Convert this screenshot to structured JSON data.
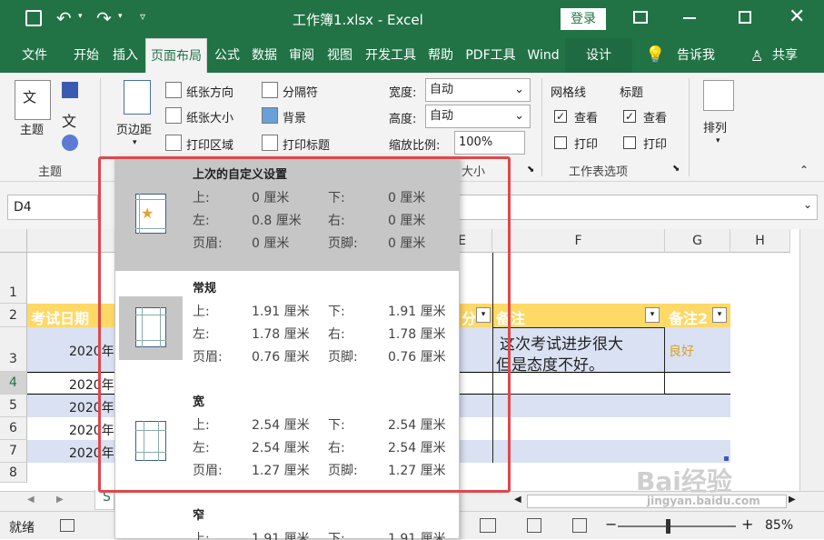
{
  "titlebar": {
    "title": "工作簿1.xlsx - Excel",
    "login_label": "登录"
  },
  "tabs": [
    "文件",
    "开始",
    "插入",
    "页面布局",
    "公式",
    "数据",
    "审阅",
    "视图",
    "开发工具",
    "帮助",
    "PDF工具",
    "Wind",
    "设计"
  ],
  "tell_me": "告诉我",
  "share": "共享",
  "ribbon": {
    "theme_btn": "主题",
    "theme_sub": "文",
    "group_theme": "主题",
    "margins_btn": "页边距",
    "orientation": "纸张方向",
    "size": "纸张大小",
    "print_area": "打印区域",
    "breaks": "分隔符",
    "background": "背景",
    "print_titles": "打印标题",
    "width_label": "宽度:",
    "width_value": "自动",
    "height_label": "高度:",
    "height_value": "自动",
    "scale_label": "缩放比例:",
    "scale_value": "100%",
    "group_scale_partial": "大小",
    "gridlines": "网格线",
    "headings": "标题",
    "view1": "查看",
    "view2": "查看",
    "print1": "打印",
    "print2": "打印",
    "group_sheet_options": "工作表选项",
    "arrange": "排列"
  },
  "namebox": "D4",
  "columns": [
    "A",
    "E",
    "F",
    "G",
    "H"
  ],
  "rows": [
    "1",
    "2",
    "3",
    "4",
    "5",
    "6",
    "7",
    "8"
  ],
  "cells": {
    "a2": "考试日期",
    "e2": "分",
    "f2": "备注",
    "g2": "备注2",
    "a3": "2020年",
    "a4": "2020年",
    "a5": "2020年",
    "a6": "2020年",
    "a7": "2020年",
    "f3_line1": "这次考试进步很大",
    "f3_line2": "但是态度不好。",
    "g3": "良好"
  },
  "sheet_tab": "S",
  "status": {
    "ready": "就绪",
    "zoom": "85%"
  },
  "margins": [
    {
      "name": "上次的自定义设置",
      "top_label": "上:",
      "top": "0 厘米",
      "bottom_label": "下:",
      "bottom": "0 厘米",
      "left_label": "左:",
      "left": "0.8 厘米",
      "right_label": "右:",
      "right": "0 厘米",
      "header_label": "页眉:",
      "header": "0 厘米",
      "footer_label": "页脚:",
      "footer": "0 厘米"
    },
    {
      "name": "常规",
      "top_label": "上:",
      "top": "1.91 厘米",
      "bottom_label": "下:",
      "bottom": "1.91 厘米",
      "left_label": "左:",
      "left": "1.78 厘米",
      "right_label": "右:",
      "right": "1.78 厘米",
      "header_label": "页眉:",
      "header": "0.76 厘米",
      "footer_label": "页脚:",
      "footer": "0.76 厘米"
    },
    {
      "name": "宽",
      "top_label": "上:",
      "top": "2.54 厘米",
      "bottom_label": "下:",
      "bottom": "2.54 厘米",
      "left_label": "左:",
      "left": "2.54 厘米",
      "right_label": "右:",
      "right": "2.54 厘米",
      "header_label": "页眉:",
      "header": "1.27 厘米",
      "footer_label": "页脚:",
      "footer": "1.27 厘米"
    },
    {
      "name": "窄",
      "top_label": "上:",
      "top": "1.91 厘米",
      "bottom_label": "下:",
      "bottom": "1.91 厘米"
    }
  ],
  "watermark": {
    "brand": "Bai经验",
    "url": "jingyan.baidu.com"
  },
  "colors": {
    "excel_green": "#217346",
    "header_yellow": "#ffd966",
    "band_blue": "#d9e1f2",
    "highlight_red": "#e0474c"
  }
}
